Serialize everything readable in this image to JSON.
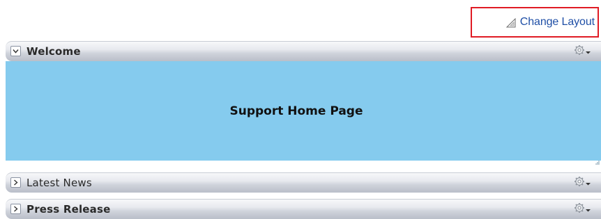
{
  "toolbar": {
    "change_layout_label": "Change Layout"
  },
  "portlets": [
    {
      "title": "Welcome",
      "state": "expanded",
      "content_heading": "Support Home Page",
      "content_color": "#85cbee"
    },
    {
      "title": "Latest News",
      "state": "collapsed"
    },
    {
      "title": "Press Release",
      "state": "collapsed"
    }
  ],
  "icons": {
    "change_layout": "triangle-ruler-icon",
    "expanded_toggle": "chevron-down-icon",
    "collapsed_toggle": "chevron-right-icon",
    "actions": "gear-icon"
  },
  "colors": {
    "highlight_border": "#e01b24",
    "link": "#1f4fa6"
  }
}
